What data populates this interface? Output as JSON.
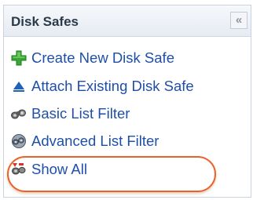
{
  "panel": {
    "title": "Disk Safes",
    "collapse_glyph": "«"
  },
  "menu": {
    "items": [
      {
        "label": "Create New Disk Safe",
        "icon": "green-plus-icon"
      },
      {
        "label": "Attach Existing Disk Safe",
        "icon": "blue-eject-triangle-icon"
      },
      {
        "label": "Basic List Filter",
        "icon": "binoculars-icon"
      },
      {
        "label": "Advanced List Filter",
        "icon": "advanced-filter-binoculars-icon"
      },
      {
        "label": "Show All",
        "icon": "show-all-binoculars-icon"
      }
    ]
  },
  "colors": {
    "link": "#1f4fa8",
    "highlight_ring": "#e8632c",
    "header_text": "#2b3a4a"
  }
}
